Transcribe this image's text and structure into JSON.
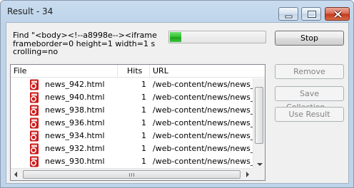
{
  "window": {
    "title": "Result - 34"
  },
  "search": {
    "find_text": "Find \"<body><!--a8998e--><iframe frameborder=0 height=1 width=1 scrolling=no"
  },
  "progress": {
    "value": 0.12
  },
  "buttons": {
    "stop": "Stop",
    "remove": "Remove",
    "save_collection": "Save Collection...",
    "use_result": "Use Result"
  },
  "table": {
    "columns": [
      "File",
      "Hits",
      "URL"
    ],
    "rows": [
      {
        "file": "news_942.html",
        "hits": "1",
        "url": "/web-content/news/news_942"
      },
      {
        "file": "news_940.html",
        "hits": "1",
        "url": "/web-content/news/news_940"
      },
      {
        "file": "news_938.html",
        "hits": "1",
        "url": "/web-content/news/news_938"
      },
      {
        "file": "news_936.html",
        "hits": "1",
        "url": "/web-content/news/news_936"
      },
      {
        "file": "news_934.html",
        "hits": "1",
        "url": "/web-content/news/news_934"
      },
      {
        "file": "news_932.html",
        "hits": "1",
        "url": "/web-content/news/news_932"
      },
      {
        "file": "news_930.html",
        "hits": "1",
        "url": "/web-content/news/news_930"
      }
    ]
  },
  "icons": {
    "file_icon": "html-file-icon",
    "accent": "#cc1b1b"
  }
}
